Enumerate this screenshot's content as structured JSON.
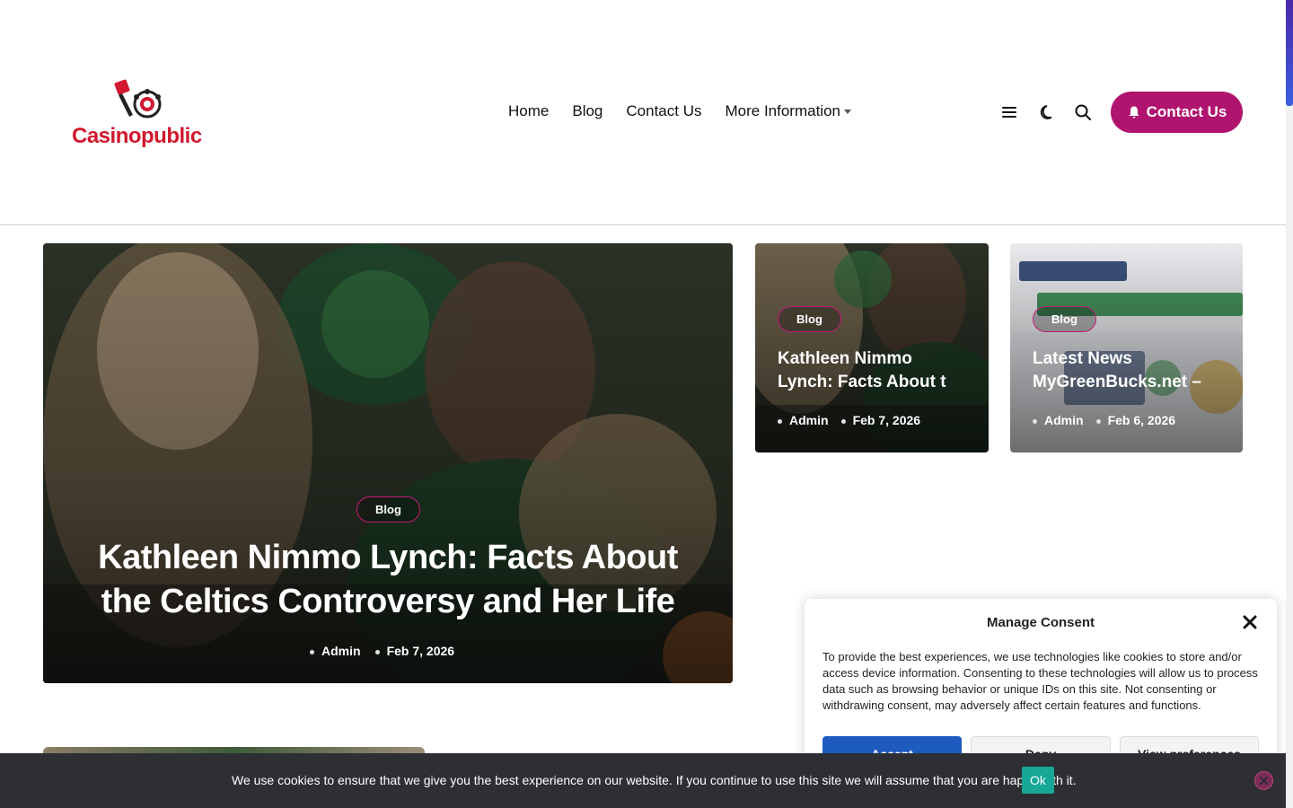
{
  "brand": {
    "name": "Casinopublic",
    "accent": "#b0146f",
    "logo_red": "#d0182e"
  },
  "nav": {
    "items": [
      {
        "label": "Home"
      },
      {
        "label": "Blog"
      },
      {
        "label": "Contact Us"
      },
      {
        "label": "More Information"
      }
    ]
  },
  "header_tools": {
    "icons": [
      "menu-icon",
      "moon-icon",
      "search-icon"
    ],
    "contact_button_label": "Contact Us",
    "contact_button_icon": "bell-icon"
  },
  "featured": {
    "tag": "Blog",
    "title": "Kathleen Nimmo Lynch: Facts About the Celtics Controversy and Her Life",
    "author": "Admin",
    "date": "Feb 7, 2026"
  },
  "cards": [
    {
      "tag": "Blog",
      "title_line1": "Kathleen Nimmo",
      "title_line2": "Lynch: Facts About t",
      "author": "Admin",
      "date": "Feb 7, 2026"
    },
    {
      "tag": "Blog",
      "title_line1": "Latest News",
      "title_line2": "MyGreenBucks.net –",
      "author": "Admin",
      "date": "Feb 6, 2026"
    }
  ],
  "consent": {
    "title": "Manage Consent",
    "text": "To provide the best experiences, we use technologies like cookies to store and/or access device information. Consenting to these technologies will allow us to process data such as browsing behavior or unique IDs on this site. Not consenting or withdrawing consent, may adversely affect certain features and functions.",
    "accept_label": "Accept",
    "deny_label": "Deny",
    "preferences_label": "View preferences"
  },
  "cookie_bar": {
    "text": "We use cookies to ensure that we give you the best experience on our website. If you continue to use this site we will assume that you are happy with it.",
    "ok_label": "Ok"
  }
}
